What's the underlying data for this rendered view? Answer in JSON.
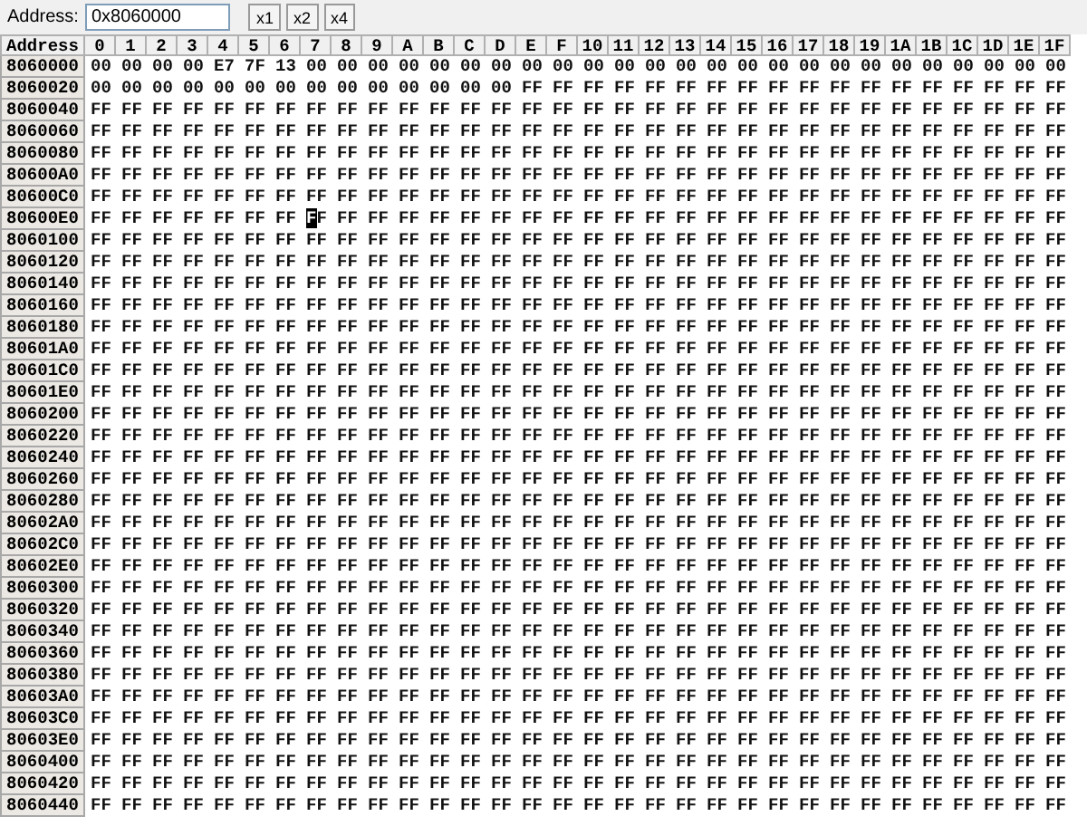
{
  "toolbar": {
    "address_label": "Address:",
    "address_value": "0x8060000",
    "zoom_buttons": [
      "x1",
      "x2",
      "x4"
    ]
  },
  "columns": [
    "Address",
    "0",
    "1",
    "2",
    "3",
    "4",
    "5",
    "6",
    "7",
    "8",
    "9",
    "A",
    "B",
    "C",
    "D",
    "E",
    "F",
    "10",
    "11",
    "12",
    "13",
    "14",
    "15",
    "16",
    "17",
    "18",
    "19",
    "1A",
    "1B",
    "1C",
    "1D",
    "1E",
    "1F"
  ],
  "rows": [
    {
      "address": "8060000",
      "cells": [
        "00",
        "00",
        "00",
        "00",
        "E7",
        "7F",
        "13",
        "00",
        "00",
        "00",
        "00",
        "00",
        "00",
        "00",
        "00",
        "00",
        "00",
        "00",
        "00",
        "00",
        "00",
        "00",
        "00",
        "00",
        "00",
        "00",
        "00",
        "00",
        "00",
        "00",
        "00",
        "00"
      ]
    },
    {
      "address": "8060020",
      "cells": [
        "00",
        "00",
        "00",
        "00",
        "00",
        "00",
        "00",
        "00",
        "00",
        "00",
        "00",
        "00",
        "00",
        "00",
        "FF",
        "FF",
        "FF",
        "FF",
        "FF",
        "FF",
        "FF",
        "FF",
        "FF",
        "FF",
        "FF",
        "FF",
        "FF",
        "FF",
        "FF",
        "FF",
        "FF",
        "FF"
      ]
    },
    {
      "address": "8060040",
      "cells": [
        "FF",
        "FF",
        "FF",
        "FF",
        "FF",
        "FF",
        "FF",
        "FF",
        "FF",
        "FF",
        "FF",
        "FF",
        "FF",
        "FF",
        "FF",
        "FF",
        "FF",
        "FF",
        "FF",
        "FF",
        "FF",
        "FF",
        "FF",
        "FF",
        "FF",
        "FF",
        "FF",
        "FF",
        "FF",
        "FF",
        "FF",
        "FF"
      ]
    },
    {
      "address": "8060060",
      "cells": [
        "FF",
        "FF",
        "FF",
        "FF",
        "FF",
        "FF",
        "FF",
        "FF",
        "FF",
        "FF",
        "FF",
        "FF",
        "FF",
        "FF",
        "FF",
        "FF",
        "FF",
        "FF",
        "FF",
        "FF",
        "FF",
        "FF",
        "FF",
        "FF",
        "FF",
        "FF",
        "FF",
        "FF",
        "FF",
        "FF",
        "FF",
        "FF"
      ]
    },
    {
      "address": "8060080",
      "cells": [
        "FF",
        "FF",
        "FF",
        "FF",
        "FF",
        "FF",
        "FF",
        "FF",
        "FF",
        "FF",
        "FF",
        "FF",
        "FF",
        "FF",
        "FF",
        "FF",
        "FF",
        "FF",
        "FF",
        "FF",
        "FF",
        "FF",
        "FF",
        "FF",
        "FF",
        "FF",
        "FF",
        "FF",
        "FF",
        "FF",
        "FF",
        "FF"
      ]
    },
    {
      "address": "80600A0",
      "cells": [
        "FF",
        "FF",
        "FF",
        "FF",
        "FF",
        "FF",
        "FF",
        "FF",
        "FF",
        "FF",
        "FF",
        "FF",
        "FF",
        "FF",
        "FF",
        "FF",
        "FF",
        "FF",
        "FF",
        "FF",
        "FF",
        "FF",
        "FF",
        "FF",
        "FF",
        "FF",
        "FF",
        "FF",
        "FF",
        "FF",
        "FF",
        "FF"
      ]
    },
    {
      "address": "80600C0",
      "cells": [
        "FF",
        "FF",
        "FF",
        "FF",
        "FF",
        "FF",
        "FF",
        "FF",
        "FF",
        "FF",
        "FF",
        "FF",
        "FF",
        "FF",
        "FF",
        "FF",
        "FF",
        "FF",
        "FF",
        "FF",
        "FF",
        "FF",
        "FF",
        "FF",
        "FF",
        "FF",
        "FF",
        "FF",
        "FF",
        "FF",
        "FF",
        "FF"
      ]
    },
    {
      "address": "80600E0",
      "cells": [
        {
          "value": "FF",
          "selected": false
        },
        {
          "value": "FF",
          "selected": false
        },
        {
          "value": "FF",
          "selected": false
        },
        {
          "value": "FF",
          "selected": false
        },
        {
          "value": "FF",
          "selected": false
        },
        {
          "value": "FF",
          "selected": false
        },
        {
          "value": "FF",
          "selected": false
        },
        {
          "value": "FF",
          "selected": true
        },
        {
          "value": "FF",
          "selected": false
        },
        {
          "value": "FF",
          "selected": false
        },
        {
          "value": "FF",
          "selected": false
        },
        {
          "value": "FF",
          "selected": false
        },
        {
          "value": "FF",
          "selected": false
        },
        {
          "value": "FF",
          "selected": false
        },
        {
          "value": "FF",
          "selected": false
        },
        {
          "value": "FF",
          "selected": false
        },
        {
          "value": "FF",
          "selected": false
        },
        {
          "value": "FF",
          "selected": false
        },
        {
          "value": "FF",
          "selected": false
        },
        {
          "value": "FF",
          "selected": false
        },
        {
          "value": "FF",
          "selected": false
        },
        {
          "value": "FF",
          "selected": false
        },
        {
          "value": "FF",
          "selected": false
        },
        {
          "value": "FF",
          "selected": false
        },
        {
          "value": "FF",
          "selected": false
        },
        {
          "value": "FF",
          "selected": false
        },
        {
          "value": "FF",
          "selected": false
        },
        {
          "value": "FF",
          "selected": false
        },
        {
          "value": "FF",
          "selected": false
        },
        {
          "value": "FF",
          "selected": false
        },
        {
          "value": "FF",
          "selected": false
        },
        {
          "value": "FF",
          "selected": false
        }
      ]
    },
    {
      "address": "8060100",
      "cells": [
        "FF",
        "FF",
        "FF",
        "FF",
        "FF",
        "FF",
        "FF",
        "FF",
        "FF",
        "FF",
        "FF",
        "FF",
        "FF",
        "FF",
        "FF",
        "FF",
        "FF",
        "FF",
        "FF",
        "FF",
        "FF",
        "FF",
        "FF",
        "FF",
        "FF",
        "FF",
        "FF",
        "FF",
        "FF",
        "FF",
        "FF",
        "FF"
      ]
    },
    {
      "address": "8060120",
      "cells": [
        "FF",
        "FF",
        "FF",
        "FF",
        "FF",
        "FF",
        "FF",
        "FF",
        "FF",
        "FF",
        "FF",
        "FF",
        "FF",
        "FF",
        "FF",
        "FF",
        "FF",
        "FF",
        "FF",
        "FF",
        "FF",
        "FF",
        "FF",
        "FF",
        "FF",
        "FF",
        "FF",
        "FF",
        "FF",
        "FF",
        "FF",
        "FF"
      ]
    },
    {
      "address": "8060140",
      "cells": [
        "FF",
        "FF",
        "FF",
        "FF",
        "FF",
        "FF",
        "FF",
        "FF",
        "FF",
        "FF",
        "FF",
        "FF",
        "FF",
        "FF",
        "FF",
        "FF",
        "FF",
        "FF",
        "FF",
        "FF",
        "FF",
        "FF",
        "FF",
        "FF",
        "FF",
        "FF",
        "FF",
        "FF",
        "FF",
        "FF",
        "FF",
        "FF"
      ]
    },
    {
      "address": "8060160",
      "cells": [
        "FF",
        "FF",
        "FF",
        "FF",
        "FF",
        "FF",
        "FF",
        "FF",
        "FF",
        "FF",
        "FF",
        "FF",
        "FF",
        "FF",
        "FF",
        "FF",
        "FF",
        "FF",
        "FF",
        "FF",
        "FF",
        "FF",
        "FF",
        "FF",
        "FF",
        "FF",
        "FF",
        "FF",
        "FF",
        "FF",
        "FF",
        "FF"
      ]
    },
    {
      "address": "8060180",
      "cells": [
        "FF",
        "FF",
        "FF",
        "FF",
        "FF",
        "FF",
        "FF",
        "FF",
        "FF",
        "FF",
        "FF",
        "FF",
        "FF",
        "FF",
        "FF",
        "FF",
        "FF",
        "FF",
        "FF",
        "FF",
        "FF",
        "FF",
        "FF",
        "FF",
        "FF",
        "FF",
        "FF",
        "FF",
        "FF",
        "FF",
        "FF",
        "FF"
      ]
    },
    {
      "address": "80601A0",
      "cells": [
        "FF",
        "FF",
        "FF",
        "FF",
        "FF",
        "FF",
        "FF",
        "FF",
        "FF",
        "FF",
        "FF",
        "FF",
        "FF",
        "FF",
        "FF",
        "FF",
        "FF",
        "FF",
        "FF",
        "FF",
        "FF",
        "FF",
        "FF",
        "FF",
        "FF",
        "FF",
        "FF",
        "FF",
        "FF",
        "FF",
        "FF",
        "FF"
      ]
    },
    {
      "address": "80601C0",
      "cells": [
        "FF",
        "FF",
        "FF",
        "FF",
        "FF",
        "FF",
        "FF",
        "FF",
        "FF",
        "FF",
        "FF",
        "FF",
        "FF",
        "FF",
        "FF",
        "FF",
        "FF",
        "FF",
        "FF",
        "FF",
        "FF",
        "FF",
        "FF",
        "FF",
        "FF",
        "FF",
        "FF",
        "FF",
        "FF",
        "FF",
        "FF",
        "FF"
      ]
    },
    {
      "address": "80601E0",
      "cells": [
        "FF",
        "FF",
        "FF",
        "FF",
        "FF",
        "FF",
        "FF",
        "FF",
        "FF",
        "FF",
        "FF",
        "FF",
        "FF",
        "FF",
        "FF",
        "FF",
        "FF",
        "FF",
        "FF",
        "FF",
        "FF",
        "FF",
        "FF",
        "FF",
        "FF",
        "FF",
        "FF",
        "FF",
        "FF",
        "FF",
        "FF",
        "FF"
      ]
    },
    {
      "address": "8060200",
      "cells": [
        "FF",
        "FF",
        "FF",
        "FF",
        "FF",
        "FF",
        "FF",
        "FF",
        "FF",
        "FF",
        "FF",
        "FF",
        "FF",
        "FF",
        "FF",
        "FF",
        "FF",
        "FF",
        "FF",
        "FF",
        "FF",
        "FF",
        "FF",
        "FF",
        "FF",
        "FF",
        "FF",
        "FF",
        "FF",
        "FF",
        "FF",
        "FF"
      ]
    },
    {
      "address": "8060220",
      "cells": [
        "FF",
        "FF",
        "FF",
        "FF",
        "FF",
        "FF",
        "FF",
        "FF",
        "FF",
        "FF",
        "FF",
        "FF",
        "FF",
        "FF",
        "FF",
        "FF",
        "FF",
        "FF",
        "FF",
        "FF",
        "FF",
        "FF",
        "FF",
        "FF",
        "FF",
        "FF",
        "FF",
        "FF",
        "FF",
        "FF",
        "FF",
        "FF"
      ]
    },
    {
      "address": "8060240",
      "cells": [
        "FF",
        "FF",
        "FF",
        "FF",
        "FF",
        "FF",
        "FF",
        "FF",
        "FF",
        "FF",
        "FF",
        "FF",
        "FF",
        "FF",
        "FF",
        "FF",
        "FF",
        "FF",
        "FF",
        "FF",
        "FF",
        "FF",
        "FF",
        "FF",
        "FF",
        "FF",
        "FF",
        "FF",
        "FF",
        "FF",
        "FF",
        "FF"
      ]
    },
    {
      "address": "8060260",
      "cells": [
        "FF",
        "FF",
        "FF",
        "FF",
        "FF",
        "FF",
        "FF",
        "FF",
        "FF",
        "FF",
        "FF",
        "FF",
        "FF",
        "FF",
        "FF",
        "FF",
        "FF",
        "FF",
        "FF",
        "FF",
        "FF",
        "FF",
        "FF",
        "FF",
        "FF",
        "FF",
        "FF",
        "FF",
        "FF",
        "FF",
        "FF",
        "FF"
      ]
    },
    {
      "address": "8060280",
      "cells": [
        "FF",
        "FF",
        "FF",
        "FF",
        "FF",
        "FF",
        "FF",
        "FF",
        "FF",
        "FF",
        "FF",
        "FF",
        "FF",
        "FF",
        "FF",
        "FF",
        "FF",
        "FF",
        "FF",
        "FF",
        "FF",
        "FF",
        "FF",
        "FF",
        "FF",
        "FF",
        "FF",
        "FF",
        "FF",
        "FF",
        "FF",
        "FF"
      ]
    },
    {
      "address": "80602A0",
      "cells": [
        "FF",
        "FF",
        "FF",
        "FF",
        "FF",
        "FF",
        "FF",
        "FF",
        "FF",
        "FF",
        "FF",
        "FF",
        "FF",
        "FF",
        "FF",
        "FF",
        "FF",
        "FF",
        "FF",
        "FF",
        "FF",
        "FF",
        "FF",
        "FF",
        "FF",
        "FF",
        "FF",
        "FF",
        "FF",
        "FF",
        "FF",
        "FF"
      ]
    },
    {
      "address": "80602C0",
      "cells": [
        "FF",
        "FF",
        "FF",
        "FF",
        "FF",
        "FF",
        "FF",
        "FF",
        "FF",
        "FF",
        "FF",
        "FF",
        "FF",
        "FF",
        "FF",
        "FF",
        "FF",
        "FF",
        "FF",
        "FF",
        "FF",
        "FF",
        "FF",
        "FF",
        "FF",
        "FF",
        "FF",
        "FF",
        "FF",
        "FF",
        "FF",
        "FF"
      ]
    },
    {
      "address": "80602E0",
      "cells": [
        "FF",
        "FF",
        "FF",
        "FF",
        "FF",
        "FF",
        "FF",
        "FF",
        "FF",
        "FF",
        "FF",
        "FF",
        "FF",
        "FF",
        "FF",
        "FF",
        "FF",
        "FF",
        "FF",
        "FF",
        "FF",
        "FF",
        "FF",
        "FF",
        "FF",
        "FF",
        "FF",
        "FF",
        "FF",
        "FF",
        "FF",
        "FF"
      ]
    },
    {
      "address": "8060300",
      "cells": [
        "FF",
        "FF",
        "FF",
        "FF",
        "FF",
        "FF",
        "FF",
        "FF",
        "FF",
        "FF",
        "FF",
        "FF",
        "FF",
        "FF",
        "FF",
        "FF",
        "FF",
        "FF",
        "FF",
        "FF",
        "FF",
        "FF",
        "FF",
        "FF",
        "FF",
        "FF",
        "FF",
        "FF",
        "FF",
        "FF",
        "FF",
        "FF"
      ]
    },
    {
      "address": "8060320",
      "cells": [
        "FF",
        "FF",
        "FF",
        "FF",
        "FF",
        "FF",
        "FF",
        "FF",
        "FF",
        "FF",
        "FF",
        "FF",
        "FF",
        "FF",
        "FF",
        "FF",
        "FF",
        "FF",
        "FF",
        "FF",
        "FF",
        "FF",
        "FF",
        "FF",
        "FF",
        "FF",
        "FF",
        "FF",
        "FF",
        "FF",
        "FF",
        "FF"
      ]
    },
    {
      "address": "8060340",
      "cells": [
        "FF",
        "FF",
        "FF",
        "FF",
        "FF",
        "FF",
        "FF",
        "FF",
        "FF",
        "FF",
        "FF",
        "FF",
        "FF",
        "FF",
        "FF",
        "FF",
        "FF",
        "FF",
        "FF",
        "FF",
        "FF",
        "FF",
        "FF",
        "FF",
        "FF",
        "FF",
        "FF",
        "FF",
        "FF",
        "FF",
        "FF",
        "FF"
      ]
    },
    {
      "address": "8060360",
      "cells": [
        "FF",
        "FF",
        "FF",
        "FF",
        "FF",
        "FF",
        "FF",
        "FF",
        "FF",
        "FF",
        "FF",
        "FF",
        "FF",
        "FF",
        "FF",
        "FF",
        "FF",
        "FF",
        "FF",
        "FF",
        "FF",
        "FF",
        "FF",
        "FF",
        "FF",
        "FF",
        "FF",
        "FF",
        "FF",
        "FF",
        "FF",
        "FF"
      ]
    },
    {
      "address": "8060380",
      "cells": [
        "FF",
        "FF",
        "FF",
        "FF",
        "FF",
        "FF",
        "FF",
        "FF",
        "FF",
        "FF",
        "FF",
        "FF",
        "FF",
        "FF",
        "FF",
        "FF",
        "FF",
        "FF",
        "FF",
        "FF",
        "FF",
        "FF",
        "FF",
        "FF",
        "FF",
        "FF",
        "FF",
        "FF",
        "FF",
        "FF",
        "FF",
        "FF"
      ]
    },
    {
      "address": "80603A0",
      "cells": [
        "FF",
        "FF",
        "FF",
        "FF",
        "FF",
        "FF",
        "FF",
        "FF",
        "FF",
        "FF",
        "FF",
        "FF",
        "FF",
        "FF",
        "FF",
        "FF",
        "FF",
        "FF",
        "FF",
        "FF",
        "FF",
        "FF",
        "FF",
        "FF",
        "FF",
        "FF",
        "FF",
        "FF",
        "FF",
        "FF",
        "FF",
        "FF"
      ]
    },
    {
      "address": "80603C0",
      "cells": [
        "FF",
        "FF",
        "FF",
        "FF",
        "FF",
        "FF",
        "FF",
        "FF",
        "FF",
        "FF",
        "FF",
        "FF",
        "FF",
        "FF",
        "FF",
        "FF",
        "FF",
        "FF",
        "FF",
        "FF",
        "FF",
        "FF",
        "FF",
        "FF",
        "FF",
        "FF",
        "FF",
        "FF",
        "FF",
        "FF",
        "FF",
        "FF"
      ]
    },
    {
      "address": "80603E0",
      "cells": [
        "FF",
        "FF",
        "FF",
        "FF",
        "FF",
        "FF",
        "FF",
        "FF",
        "FF",
        "FF",
        "FF",
        "FF",
        "FF",
        "FF",
        "FF",
        "FF",
        "FF",
        "FF",
        "FF",
        "FF",
        "FF",
        "FF",
        "FF",
        "FF",
        "FF",
        "FF",
        "FF",
        "FF",
        "FF",
        "FF",
        "FF",
        "FF"
      ]
    },
    {
      "address": "8060400",
      "cells": [
        "FF",
        "FF",
        "FF",
        "FF",
        "FF",
        "FF",
        "FF",
        "FF",
        "FF",
        "FF",
        "FF",
        "FF",
        "FF",
        "FF",
        "FF",
        "FF",
        "FF",
        "FF",
        "FF",
        "FF",
        "FF",
        "FF",
        "FF",
        "FF",
        "FF",
        "FF",
        "FF",
        "FF",
        "FF",
        "FF",
        "FF",
        "FF"
      ]
    },
    {
      "address": "8060420",
      "cells": [
        "FF",
        "FF",
        "FF",
        "FF",
        "FF",
        "FF",
        "FF",
        "FF",
        "FF",
        "FF",
        "FF",
        "FF",
        "FF",
        "FF",
        "FF",
        "FF",
        "FF",
        "FF",
        "FF",
        "FF",
        "FF",
        "FF",
        "FF",
        "FF",
        "FF",
        "FF",
        "FF",
        "FF",
        "FF",
        "FF",
        "FF",
        "FF"
      ]
    },
    {
      "address": "8060440",
      "cells": [
        "FF",
        "FF",
        "FF",
        "FF",
        "FF",
        "FF",
        "FF",
        "FF",
        "FF",
        "FF",
        "FF",
        "FF",
        "FF",
        "FF",
        "FF",
        "FF",
        "FF",
        "FF",
        "FF",
        "FF",
        "FF",
        "FF",
        "FF",
        "FF",
        "FF",
        "FF",
        "FF",
        "FF",
        "FF",
        "FF",
        "FF",
        "FF"
      ]
    }
  ]
}
